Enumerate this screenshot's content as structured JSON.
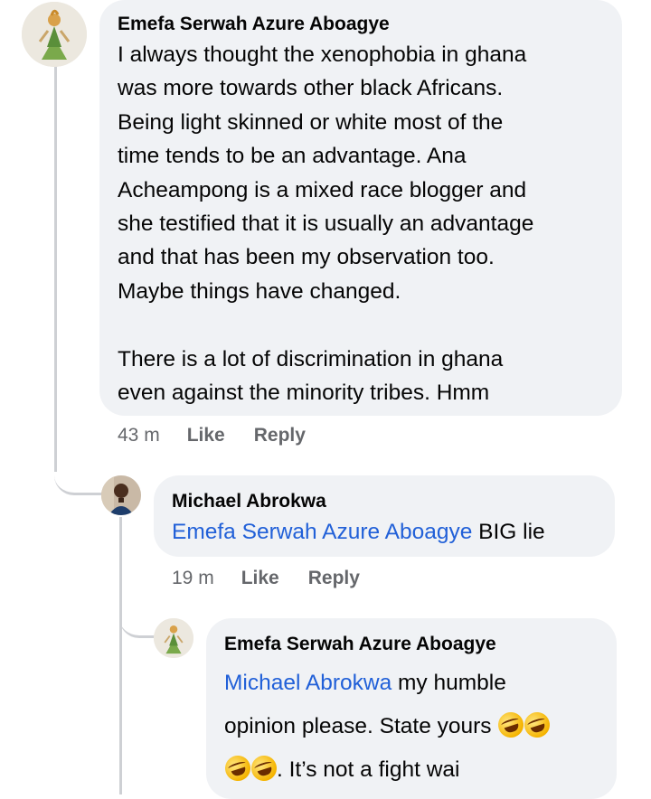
{
  "comments": [
    {
      "author": "Emefa Serwah Azure Aboagye",
      "lines": [
        "I always thought the xenophobia in ghana",
        "was more towards other black Africans.",
        "Being light skinned or white most of the",
        "time tends to be an advantage. Ana",
        "Acheampong is a mixed race blogger and",
        "she testified that it is usually an advantage",
        "and that has been my observation too.",
        "Maybe things have changed.",
        "",
        "There is a lot of discrimination in ghana",
        "even against the minority tribes. Hmm"
      ],
      "time": "43 m",
      "like": "Like",
      "reply": "Reply"
    },
    {
      "author": "Michael Abrokwa",
      "mention": "Emefa Serwah Azure Aboagye",
      "text": " BIG lie",
      "time": "19 m",
      "like": "Like",
      "reply": "Reply"
    },
    {
      "author": "Emefa Serwah Azure Aboagye",
      "mention": "Michael Abrokwa",
      "line1": " my humble",
      "line2": "opinion please. State yours ",
      "line3": ". It’s not a fight wai",
      "emoji": "rolling-on-floor-laughing-emoji"
    }
  ],
  "colors": {
    "bubble": "#f0f2f5",
    "mention": "#2160d8",
    "meta": "#65676b",
    "thread": "#ced0d4"
  }
}
